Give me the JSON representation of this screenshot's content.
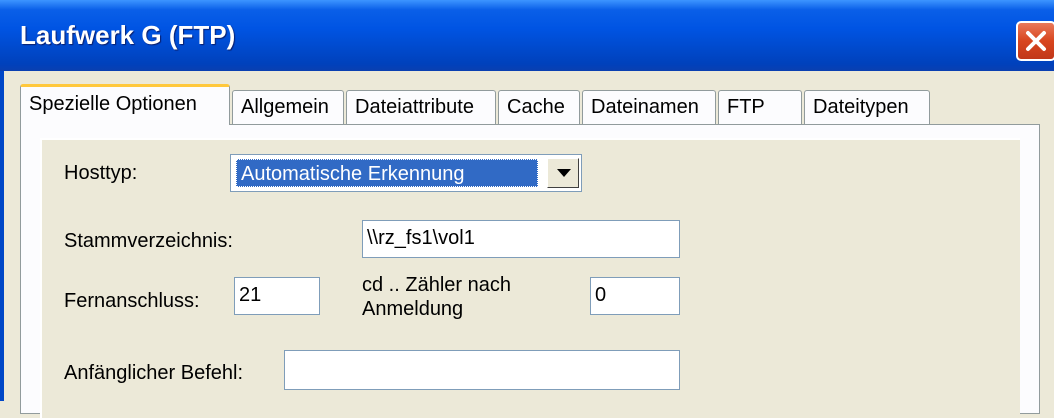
{
  "window": {
    "title": "Laufwerk G (FTP)",
    "close_icon": "close-icon"
  },
  "tabs": [
    {
      "label": "Spezielle Optionen",
      "active": true
    },
    {
      "label": "Allgemein"
    },
    {
      "label": "Dateiattribute"
    },
    {
      "label": "Cache"
    },
    {
      "label": "Dateinamen"
    },
    {
      "label": "FTP"
    },
    {
      "label": "Dateitypen"
    }
  ],
  "form": {
    "hosttyp_label": "Hosttyp:",
    "hosttyp_value": "Automatische Erkennung",
    "dropdown_icon": "chevron-down-icon",
    "stammverzeichnis_label": "Stammverzeichnis:",
    "stammverzeichnis_value": "\\\\rz_fs1\\vol1",
    "fernanschluss_label": "Fernanschluss:",
    "fernanschluss_value": "21",
    "cd_zaehler_label_line1": "cd .. Zähler nach",
    "cd_zaehler_label_line2": "Anmeldung",
    "cd_zaehler_value": "0",
    "befehl_label": "Anfänglicher Befehl:",
    "befehl_value": ""
  },
  "colors": {
    "titlebar": "#0054E3",
    "selection": "#316AC5",
    "dialog_bg": "#ECE9D8",
    "close": "#D8451E",
    "active_tab_accent": "#FFC83C"
  }
}
